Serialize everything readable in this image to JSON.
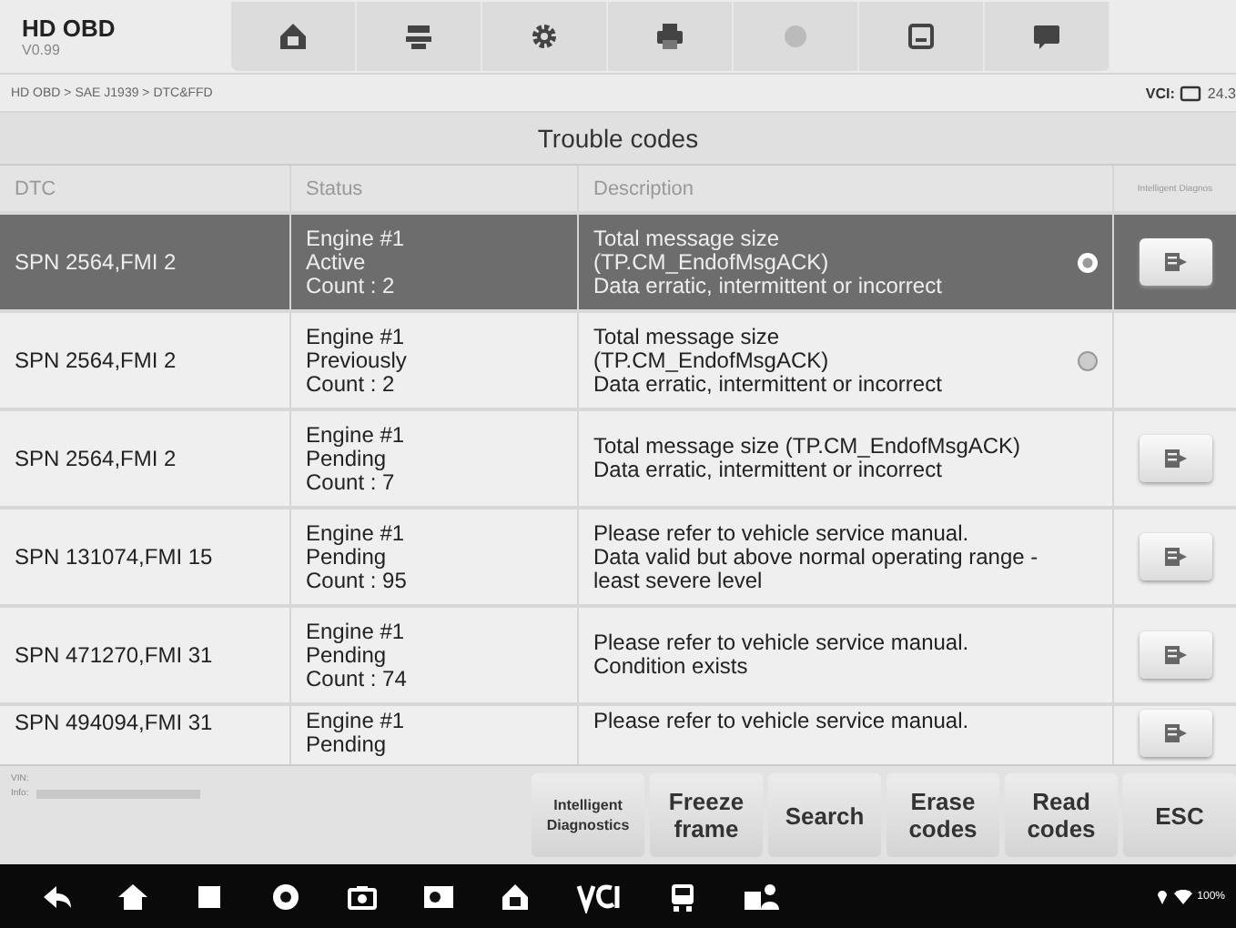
{
  "app": {
    "title": "HD OBD",
    "version": "V0.99"
  },
  "breadcrumb": "HD OBD > SAE J1939 > DTC&FFD",
  "vci": {
    "label": "VCI:",
    "value": "24.3"
  },
  "panel_title": "Trouble codes",
  "table": {
    "columns": [
      "DTC",
      "Status",
      "Description",
      "Intelligent Diagnos"
    ],
    "rows": [
      {
        "dtc": "SPN 2564,FMI 2",
        "status": [
          "Engine #1",
          "Active",
          "Count : 2"
        ],
        "description": [
          "Total message size",
          "(TP.CM_EndofMsgACK)",
          "Data erratic, intermittent or incorrect"
        ],
        "selected": true,
        "freeze_frame": true,
        "diagnose_button": true
      },
      {
        "dtc": "SPN 2564,FMI 2",
        "status": [
          "Engine #1",
          "Previously",
          "Count : 2"
        ],
        "description": [
          "Total message size",
          "(TP.CM_EndofMsgACK)",
          "Data erratic, intermittent or incorrect"
        ],
        "selected": false,
        "freeze_frame": true,
        "diagnose_button": false
      },
      {
        "dtc": "SPN 2564,FMI 2",
        "status": [
          "Engine #1",
          "Pending",
          "Count : 7"
        ],
        "description": [
          "Total message size (TP.CM_EndofMsgACK)",
          "Data erratic, intermittent or incorrect"
        ],
        "selected": false,
        "freeze_frame": false,
        "diagnose_button": true
      },
      {
        "dtc": "SPN 131074,FMI 15",
        "status": [
          "Engine #1",
          "Pending",
          "Count : 95"
        ],
        "description": [
          "Please refer to vehicle service manual.",
          "Data valid but above normal operating range -",
          "least severe level"
        ],
        "selected": false,
        "freeze_frame": false,
        "diagnose_button": true
      },
      {
        "dtc": "SPN 471270,FMI 31",
        "status": [
          "Engine #1",
          "Pending",
          "Count : 74"
        ],
        "description": [
          "Please refer to vehicle service manual.",
          "Condition exists"
        ],
        "selected": false,
        "freeze_frame": false,
        "diagnose_button": true
      },
      {
        "dtc": "SPN 494094,FMI 31",
        "status": [
          "Engine #1",
          "Pending"
        ],
        "description": [
          "Please refer to vehicle service manual."
        ],
        "selected": false,
        "freeze_frame": false,
        "diagnose_button": true
      }
    ]
  },
  "info": {
    "vin_label": "VIN:",
    "info_label": "Info:"
  },
  "buttons": [
    "Intelligent Diagnostics",
    "Freeze frame",
    "Search",
    "Erase codes",
    "Read codes",
    "ESC"
  ],
  "system_status": {
    "battery": "100%"
  }
}
